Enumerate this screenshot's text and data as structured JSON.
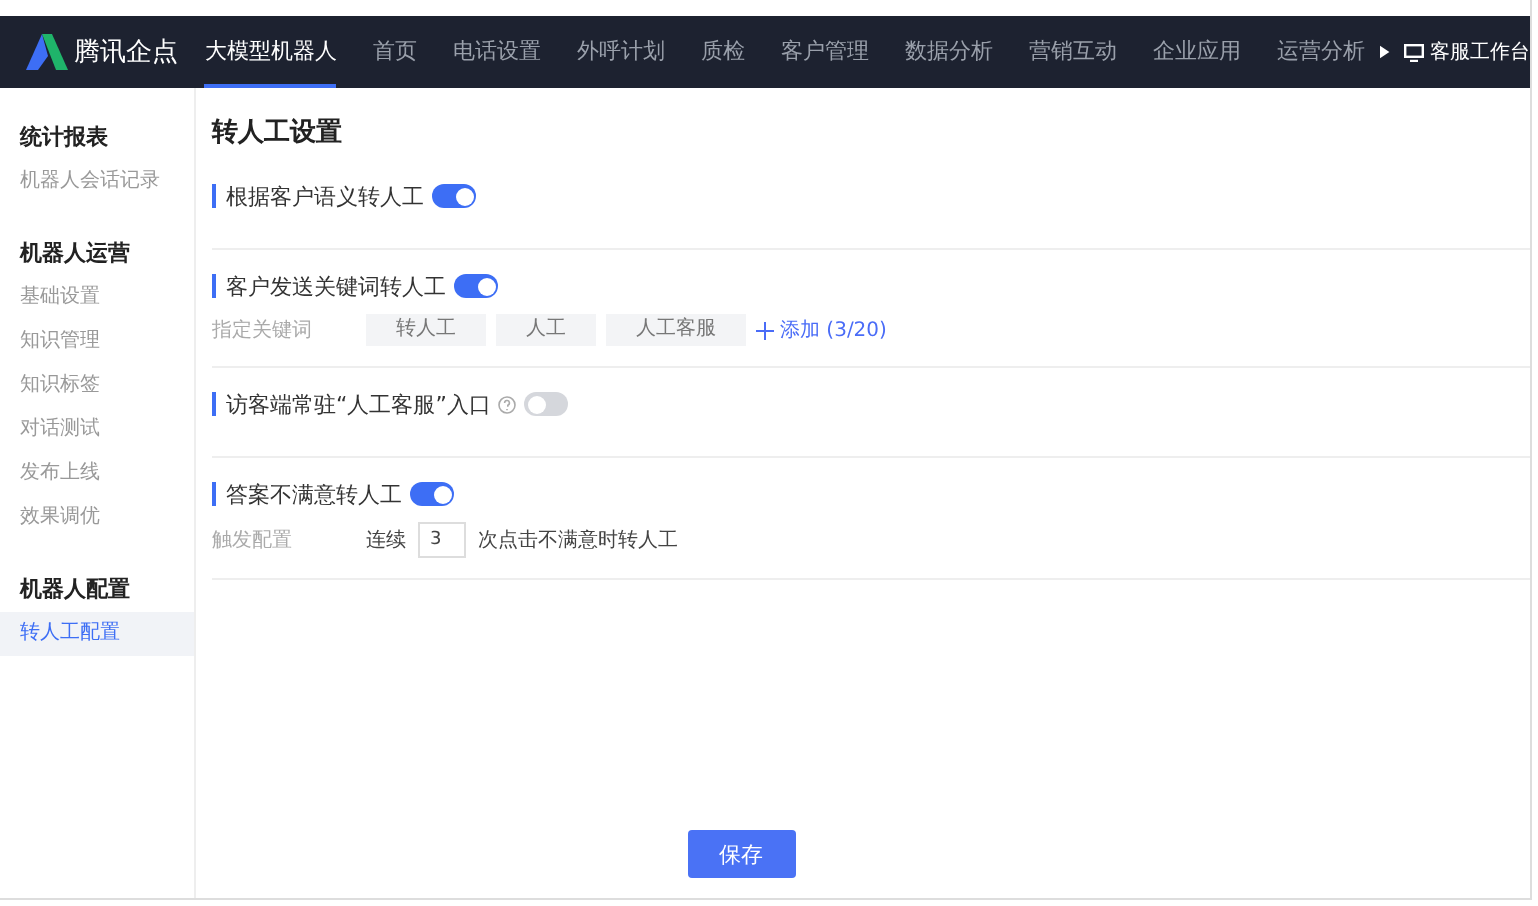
{
  "brand": {
    "name": "腾讯企点"
  },
  "nav": {
    "items": [
      {
        "label": "大模型机器人",
        "selected": true
      },
      {
        "label": "首页",
        "selected": false
      },
      {
        "label": "电话设置",
        "selected": false
      },
      {
        "label": "外呼计划",
        "selected": false
      },
      {
        "label": "质检",
        "selected": false
      },
      {
        "label": "客户管理",
        "selected": false
      },
      {
        "label": "数据分析",
        "selected": false
      },
      {
        "label": "营销互动",
        "selected": false
      },
      {
        "label": "企业应用",
        "selected": false
      },
      {
        "label": "运营分析",
        "selected": false
      }
    ],
    "workbench": "客服工作台"
  },
  "sidebar": {
    "groups": [
      {
        "title": "统计报表",
        "items": [
          {
            "label": "机器人会话记录",
            "selected": false
          }
        ]
      },
      {
        "title": "机器人运营",
        "items": [
          {
            "label": "基础设置",
            "selected": false
          },
          {
            "label": "知识管理",
            "selected": false
          },
          {
            "label": "知识标签",
            "selected": false
          },
          {
            "label": "对话测试",
            "selected": false
          },
          {
            "label": "发布上线",
            "selected": false
          },
          {
            "label": "效果调优",
            "selected": false
          }
        ]
      },
      {
        "title": "机器人配置",
        "items": [
          {
            "label": "转人工配置",
            "selected": true
          }
        ]
      }
    ]
  },
  "page": {
    "title": "转人工设置",
    "sections": [
      {
        "title": "根据客户语义转人工",
        "help": false,
        "on": true
      },
      {
        "title": "客户发送关键词转人工",
        "help": false,
        "on": true,
        "detail": {
          "kind": "keywords",
          "label": "指定关键词",
          "tags": [
            "转人工",
            "人工",
            "人工客服"
          ],
          "add": "添加 (3/20)"
        }
      },
      {
        "title": "访客端常驻“人工客服”入口",
        "help": true,
        "on": false
      },
      {
        "title": "答案不满意转人工",
        "help": false,
        "on": true,
        "detail": {
          "kind": "trigger",
          "label": "触发配置",
          "prefix": "连续",
          "value": "3",
          "suffix": "次点击不满意时转人工"
        }
      }
    ],
    "save": "保存"
  }
}
